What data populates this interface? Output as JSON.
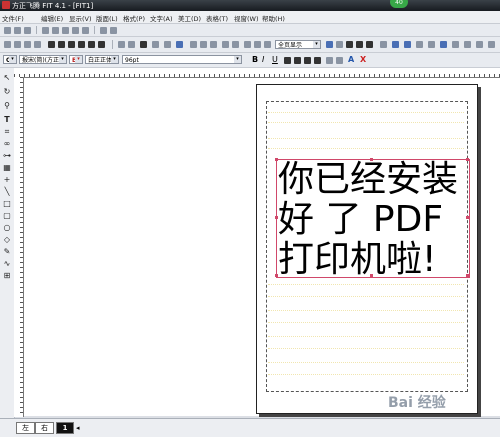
{
  "window": {
    "title": "方正飞腾 FIT 4.1 - [FIT1]",
    "badge": "40"
  },
  "menu": [
    "文件(F)",
    "编辑(E)",
    "显示(V)",
    "版面(L)",
    "格式(P)",
    "文字(A)",
    "美工(D)",
    "表格(T)",
    "视窗(W)",
    "帮助(H)"
  ],
  "toolbar2": {
    "zoom": "全页显示"
  },
  "format_bar": {
    "style_letter": "C",
    "font_cn": "报宋(简)(方正)",
    "font_en_letter": "E",
    "font_en": "白正正体",
    "size": "96pt",
    "bold": "B",
    "italic": "I",
    "underline": "U",
    "font_icon_a": "A",
    "delete": "X"
  },
  "document": {
    "lines": [
      "你已经安装",
      "好 了 PDF",
      "打印机啦!"
    ]
  },
  "status": {
    "tab_left": "左",
    "tab_right": "右",
    "page_current": "1"
  },
  "watermark": "Bai 经验"
}
